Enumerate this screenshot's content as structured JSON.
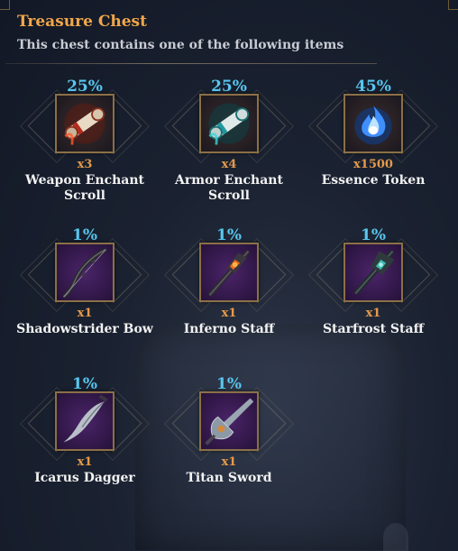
{
  "window": {
    "title": "Treasure Chest",
    "subtitle": "This chest contains one of the following items"
  },
  "items": [
    {
      "chance": "25%",
      "qty": "x3",
      "name_line1": "Weapon Enchant",
      "name_line2": "Scroll",
      "icon": "weapon-enchant-scroll-icon"
    },
    {
      "chance": "25%",
      "qty": "x4",
      "name_line1": "Armor Enchant",
      "name_line2": "Scroll",
      "icon": "armor-enchant-scroll-icon"
    },
    {
      "chance": "45%",
      "qty": "x1500",
      "name_line1": "Essence Token",
      "name_line2": "",
      "icon": "essence-token-icon"
    },
    {
      "chance": "1%",
      "qty": "x1",
      "name_line1": "Shadowstrider Bow",
      "name_line2": "",
      "icon": "bow-icon"
    },
    {
      "chance": "1%",
      "qty": "x1",
      "name_line1": "Inferno Staff",
      "name_line2": "",
      "icon": "staff-icon"
    },
    {
      "chance": "1%",
      "qty": "x1",
      "name_line1": "Starfrost Staff",
      "name_line2": "",
      "icon": "staff-icon"
    },
    {
      "chance": "1%",
      "qty": "x1",
      "name_line1": "Icarus Dagger",
      "name_line2": "",
      "icon": "dagger-icon"
    },
    {
      "chance": "1%",
      "qty": "x1",
      "name_line1": "Titan Sword",
      "name_line2": "",
      "icon": "sword-icon"
    }
  ],
  "colors": {
    "title": "#f0a74a",
    "chance": "#58c6ee",
    "quantity": "#e59a4a",
    "frame_border": "#8b7046",
    "epic_background": "#4a2468"
  }
}
